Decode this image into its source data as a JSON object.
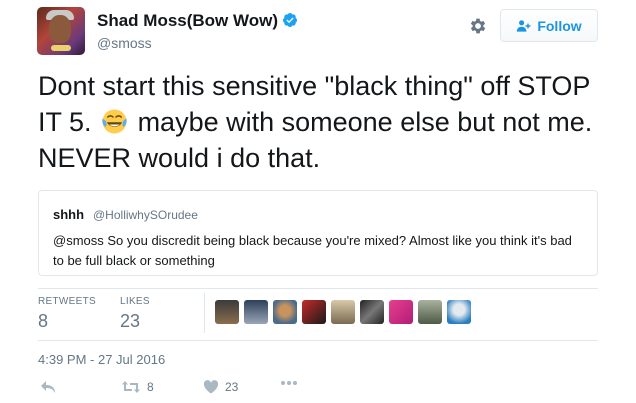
{
  "user": {
    "name": "Shad Moss(Bow Wow)",
    "handle": "@smoss",
    "verified_icon": "verified-badge-icon"
  },
  "follow": {
    "label": "Follow"
  },
  "tweet": {
    "line1": "Dont start this sensitive \"black thing\" off STOP",
    "line2_a": "IT 5.",
    "line2_b": "maybe with someone else but not me.",
    "line3": "NEVER would i do that.",
    "emoji": "face-with-tears-of-joy-icon"
  },
  "quote": {
    "name": "shhh",
    "handle": "@HolliwhySOrudee",
    "text": "@smoss So you discredit being black because you're mixed? Almost like you think it's bad to be full black or something"
  },
  "stats": {
    "retweets_label": "RETWEETS",
    "retweets": "8",
    "likes_label": "LIKES",
    "likes": "23"
  },
  "timestamp": "4:39 PM - 27 Jul 2016",
  "actions": {
    "retweet_count": "8",
    "like_count": "23"
  },
  "colors": {
    "accent": "#1b95e0",
    "muted": "#657786",
    "text": "#14171a",
    "border": "#e1e8ed"
  }
}
